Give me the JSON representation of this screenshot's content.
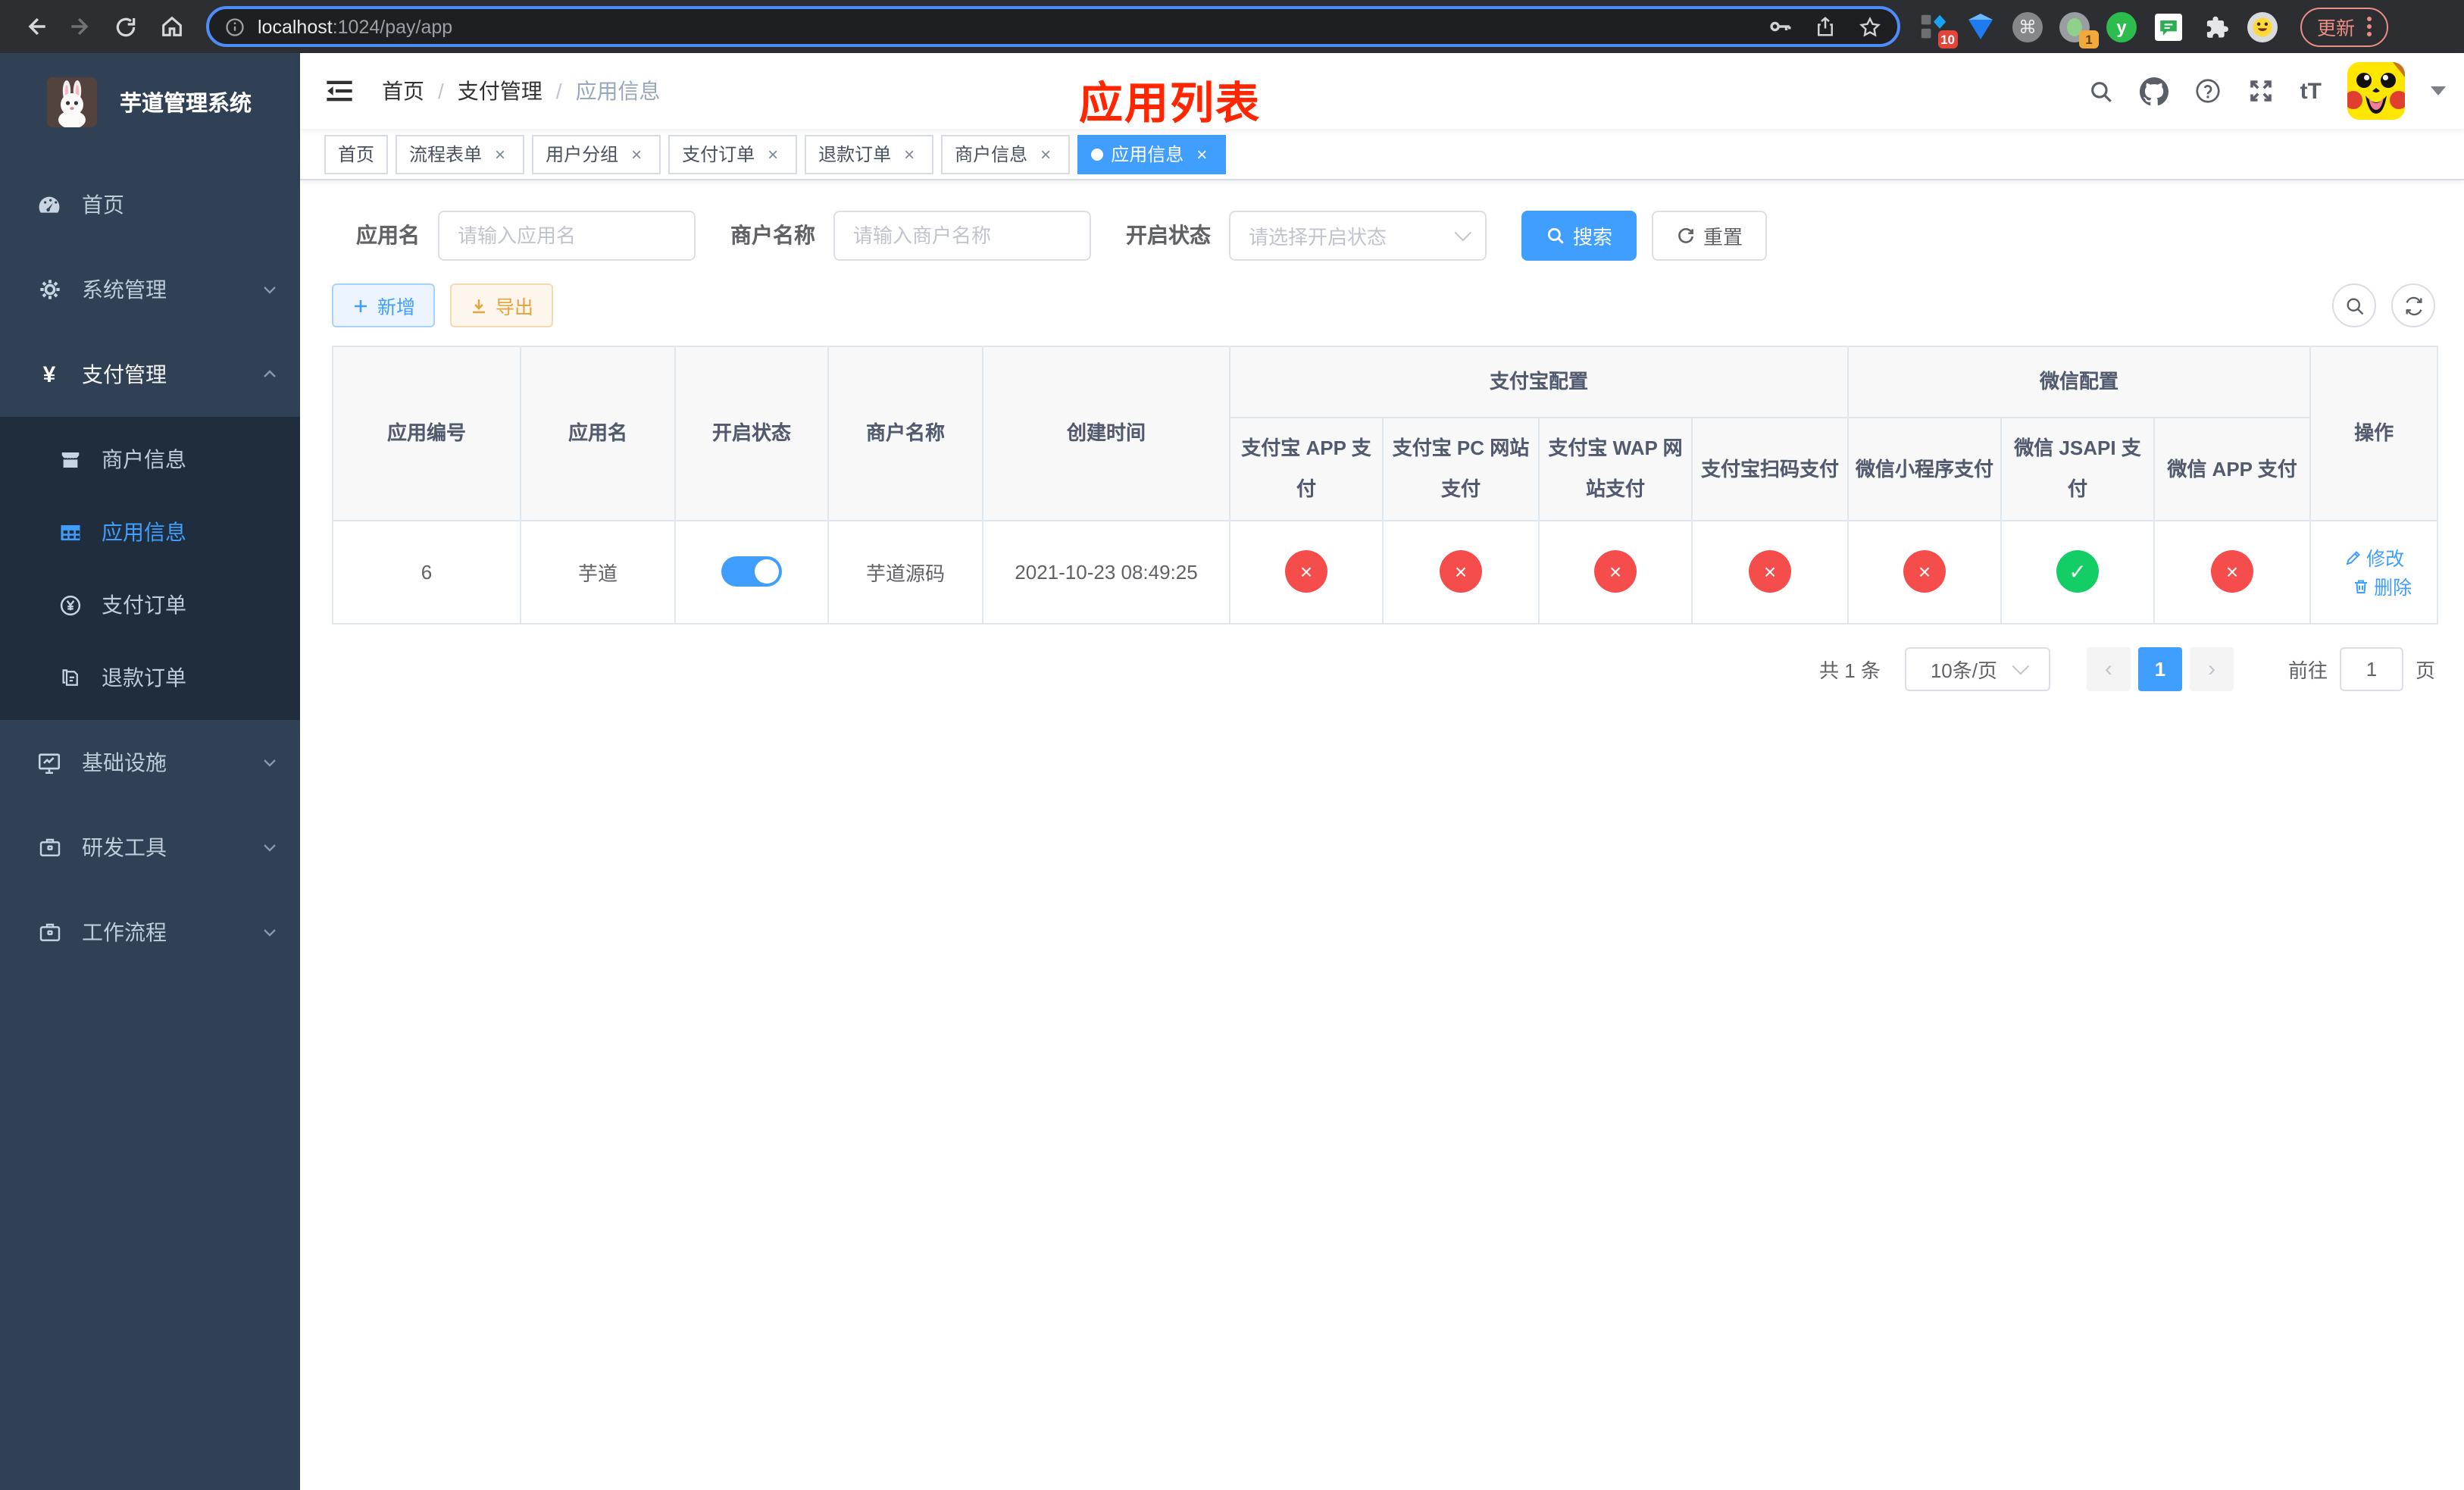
{
  "colors": {
    "primary": "#409eff",
    "danger": "#f54c4c",
    "success": "#13ce66",
    "warning": "#e6a23c",
    "annotation_red": "#ff2600",
    "sidebar_bg": "#304156",
    "submenu_bg": "#1f2d3d"
  },
  "browser": {
    "url_host": "localhost",
    "url_path": ":1024/pay/app",
    "update_label": "更新",
    "ext_badge_grid": "10",
    "ext_badge_proxy": "1",
    "ext_letter": "y",
    "cmd_glyph": "⌘"
  },
  "sidebar": {
    "title": "芋道管理系统",
    "menu": [
      {
        "label": "首页",
        "expandable": false
      },
      {
        "label": "系统管理",
        "expandable": true
      },
      {
        "label": "支付管理",
        "expandable": true,
        "expanded": true
      },
      {
        "label": "基础设施",
        "expandable": true
      },
      {
        "label": "研发工具",
        "expandable": true
      },
      {
        "label": "工作流程",
        "expandable": true
      }
    ],
    "submenu": [
      {
        "label": "商户信息",
        "active": false
      },
      {
        "label": "应用信息",
        "active": true
      },
      {
        "label": "支付订单",
        "active": false
      },
      {
        "label": "退款订单",
        "active": false
      }
    ]
  },
  "header": {
    "breadcrumb": [
      "首页",
      "支付管理",
      "应用信息"
    ],
    "breadcrumb_sep": "/",
    "overlay_title": "应用列表"
  },
  "tabs": [
    {
      "label": "首页",
      "closable": false,
      "active": false
    },
    {
      "label": "流程表单",
      "closable": true,
      "active": false
    },
    {
      "label": "用户分组",
      "closable": true,
      "active": false
    },
    {
      "label": "支付订单",
      "closable": true,
      "active": false
    },
    {
      "label": "退款订单",
      "closable": true,
      "active": false
    },
    {
      "label": "商户信息",
      "closable": true,
      "active": false
    },
    {
      "label": "应用信息",
      "closable": true,
      "active": true
    }
  ],
  "filters": {
    "app_name_label": "应用名",
    "app_name_placeholder": "请输入应用名",
    "merchant_label": "商户名称",
    "merchant_placeholder": "请输入商户名称",
    "status_label": "开启状态",
    "status_placeholder": "请选择开启状态",
    "search_label": "搜索",
    "reset_label": "重置"
  },
  "toolbar": {
    "add_label": "新增",
    "export_label": "导出"
  },
  "table": {
    "groups": [
      {
        "label": "支付宝配置",
        "span": 4
      },
      {
        "label": "微信配置",
        "span": 3
      }
    ],
    "columns": [
      {
        "label": "应用编号"
      },
      {
        "label": "应用名"
      },
      {
        "label": "开启状态"
      },
      {
        "label": "商户名称"
      },
      {
        "label": "创建时间"
      },
      {
        "label": "支付宝 APP 支付"
      },
      {
        "label": "支付宝 PC 网站支付"
      },
      {
        "label": "支付宝 WAP 网站支付"
      },
      {
        "label": "支付宝扫码支付"
      },
      {
        "label": "微信小程序支付"
      },
      {
        "label": "微信 JSAPI 支付"
      },
      {
        "label": "微信 APP 支付"
      },
      {
        "label": "操作"
      }
    ],
    "row": {
      "id": "6",
      "name": "芋道",
      "enabled": true,
      "merchant": "芋道源码",
      "created": "2021-10-23 08:49:25",
      "pay_status": [
        false,
        false,
        false,
        false,
        false,
        true,
        false
      ]
    },
    "actions": {
      "edit": "修改",
      "delete": "删除"
    }
  },
  "pagination": {
    "total": "共 1 条",
    "page_size": "10条/页",
    "current_page": "1",
    "goto_label": "前往",
    "goto_value": "1",
    "goto_suffix": "页"
  },
  "icons": {
    "close": "×",
    "check": "✓",
    "cross": "×",
    "prev": "‹",
    "next": "›",
    "font_size": "tT"
  }
}
